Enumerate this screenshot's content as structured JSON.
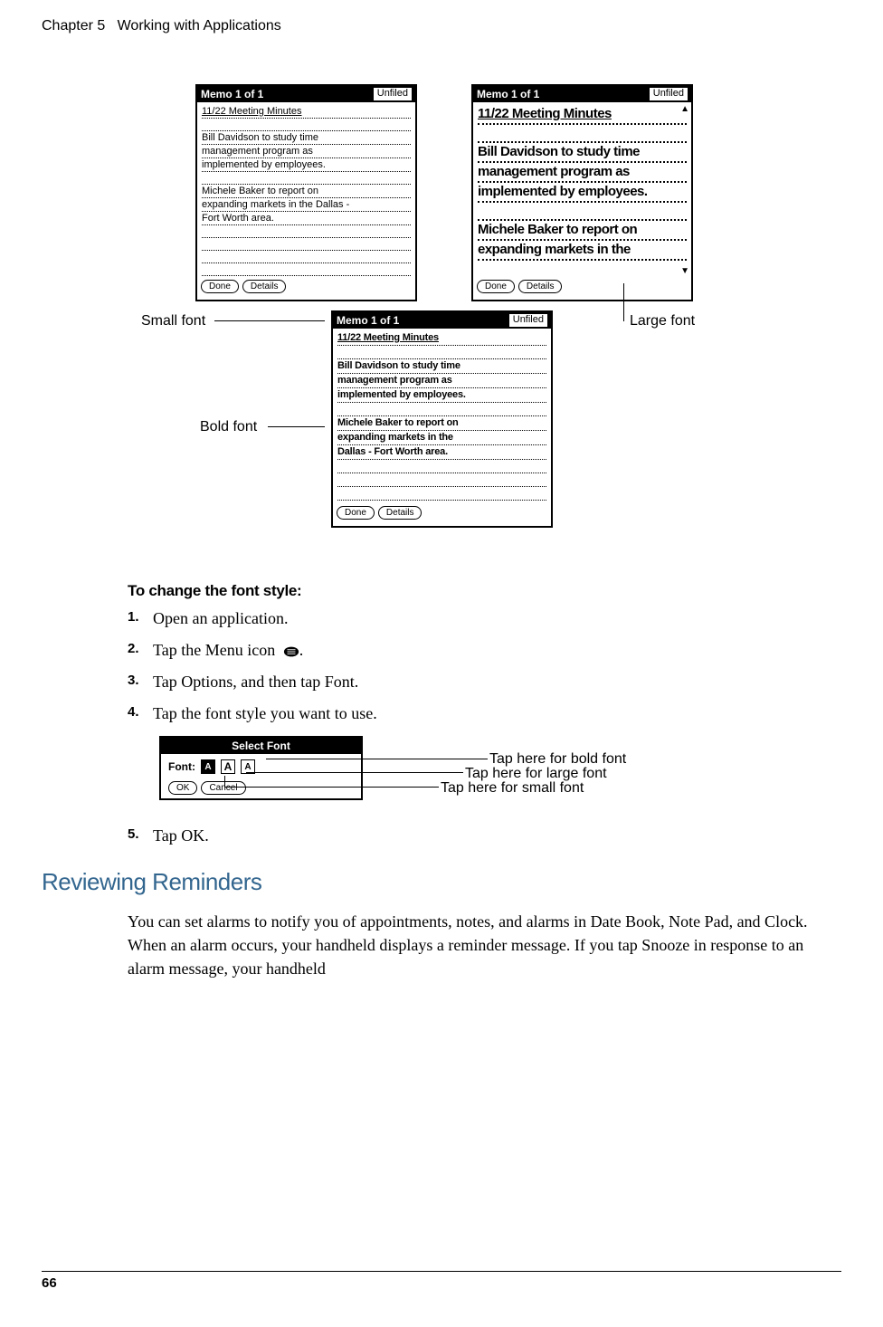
{
  "header": {
    "chapter": "Chapter 5",
    "title": "Working with Applications"
  },
  "memo": {
    "title": "Memo 1 of 1",
    "category": "Unfiled",
    "heading": "11/22 Meeting Minutes",
    "small_lines": [
      "Bill Davidson to study time",
      "management program as",
      "implemented by employees.",
      "",
      "Michele Baker to report on",
      "expanding markets in the Dallas -",
      "Fort Worth area."
    ],
    "large_lines": [
      "Bill Davidson to study time",
      "management program as",
      "implemented by employees.",
      "",
      "Michele Baker to report on",
      "expanding markets in the"
    ],
    "bold_lines": [
      "Bill Davidson to study time",
      "management program as",
      "implemented by employees.",
      "",
      "Michele Baker to report on",
      "expanding markets in the",
      "Dallas - Fort Worth area."
    ],
    "done": "Done",
    "details": "Details"
  },
  "callouts": {
    "small_font": "Small font",
    "large_font": "Large font",
    "bold_font": "Bold font"
  },
  "instructions": {
    "heading": "To change the font style:",
    "step1_num": "1.",
    "step1": "Open an application.",
    "step2_num": "2.",
    "step2": "Tap the Menu icon ",
    "step2_end": ".",
    "step3_num": "3.",
    "step3": "Tap Options, and then tap Font.",
    "step4_num": "4.",
    "step4": "Tap the font style you want to use.",
    "step5_num": "5.",
    "step5": "Tap OK."
  },
  "select_font": {
    "title": "Select Font",
    "label": "Font:",
    "a": "A",
    "ok": "OK",
    "cancel": "Cancel",
    "tap_bold": "Tap here for bold font",
    "tap_large": "Tap here for large font",
    "tap_small": "Tap here for small font"
  },
  "section": {
    "heading": "Reviewing Reminders",
    "body": "You can set alarms to notify you of appointments, notes, and alarms in Date Book, Note Pad, and Clock. When an alarm occurs, your handheld displays a reminder message. If you tap Snooze in response to an alarm message, your handheld"
  },
  "footer": {
    "page": "66"
  }
}
